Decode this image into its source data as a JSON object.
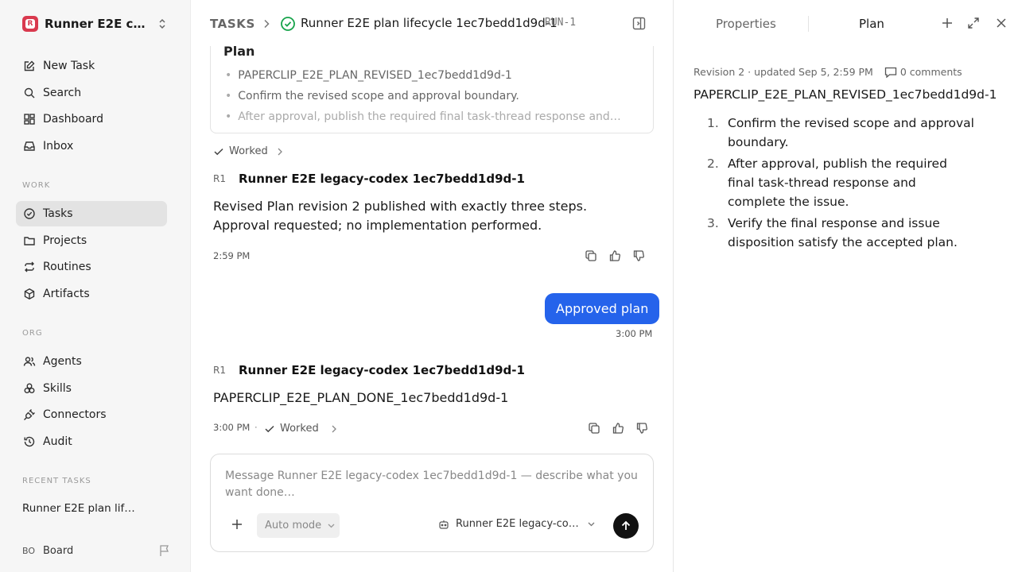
{
  "workspace": {
    "name": "Runner E2E co…",
    "logo_letter": "R"
  },
  "nav": {
    "primary": [
      {
        "label": "New Task",
        "icon": "edit-icon"
      },
      {
        "label": "Search",
        "icon": "search-icon"
      },
      {
        "label": "Dashboard",
        "icon": "dashboard-icon"
      },
      {
        "label": "Inbox",
        "icon": "inbox-icon"
      }
    ],
    "work_label": "WORK",
    "work": [
      {
        "label": "Tasks",
        "icon": "check-circle-icon",
        "active": true
      },
      {
        "label": "Projects",
        "icon": "folder-icon"
      },
      {
        "label": "Routines",
        "icon": "repeat-icon"
      },
      {
        "label": "Artifacts",
        "icon": "box-icon"
      }
    ],
    "org_label": "ORG",
    "org": [
      {
        "label": "Agents",
        "icon": "users-icon"
      },
      {
        "label": "Skills",
        "icon": "skills-icon"
      },
      {
        "label": "Connectors",
        "icon": "plug-icon"
      },
      {
        "label": "Audit",
        "icon": "history-icon"
      }
    ],
    "recent_label": "RECENT TASKS",
    "recent": [
      {
        "label": "Runner E2E plan lif…"
      }
    ],
    "board": {
      "avatar": "BO",
      "label": "Board"
    }
  },
  "header": {
    "section": "TASKS",
    "title": "Runner E2E plan lifecycle 1ec7bedd1d9d-1",
    "run_id": "RUN-1"
  },
  "plan_card": {
    "title": "Plan",
    "items": [
      "PAPERCLIP_E2E_PLAN_REVISED_1ec7bedd1d9d-1",
      "Confirm the revised scope and approval boundary.",
      "After approval, publish the required final task-thread response and…"
    ]
  },
  "thread": {
    "worked_label": "Worked",
    "messages": [
      {
        "badge": "R1",
        "author": "Runner E2E legacy-codex 1ec7bedd1d9d-1",
        "text": "Revised Plan revision 2 published with exactly three steps. Approval requested; no implementation performed.",
        "time": "2:59 PM"
      },
      {
        "badge": "R1",
        "author": "Runner E2E legacy-codex 1ec7bedd1d9d-1",
        "text": "PAPERCLIP_E2E_PLAN_DONE_1ec7bedd1d9d-1",
        "time": "3:00 PM",
        "separator": "·"
      }
    ],
    "user_message": {
      "text": "Approved plan",
      "time": "3:00 PM",
      "color": "#2563eb"
    }
  },
  "composer": {
    "placeholder": "Message Runner E2E legacy-codex 1ec7bedd1d9d-1 — describe what you want done…",
    "mode": "Auto mode",
    "agent": "Runner E2E legacy-codex 1ec7bedd1d9d-1"
  },
  "right_panel": {
    "tabs": [
      {
        "label": "Properties"
      },
      {
        "label": "Plan",
        "active": true
      }
    ],
    "meta": "Revision 2 · updated Sep 5, 2:59 PM",
    "comments": "0 comments",
    "title": "PAPERCLIP_E2E_PLAN_REVISED_1ec7bedd1d9d-1",
    "steps": [
      {
        "num": "1.",
        "text": "Confirm the revised scope and approval boundary."
      },
      {
        "num": "2.",
        "text": "After approval, publish the required final task-thread response and complete the issue."
      },
      {
        "num": "3.",
        "text": "Verify the final response and issue disposition satisfy the accepted plan."
      }
    ]
  },
  "colors": {
    "accent": "#2563eb",
    "success": "#16a34a",
    "brand": "#d9394e"
  }
}
